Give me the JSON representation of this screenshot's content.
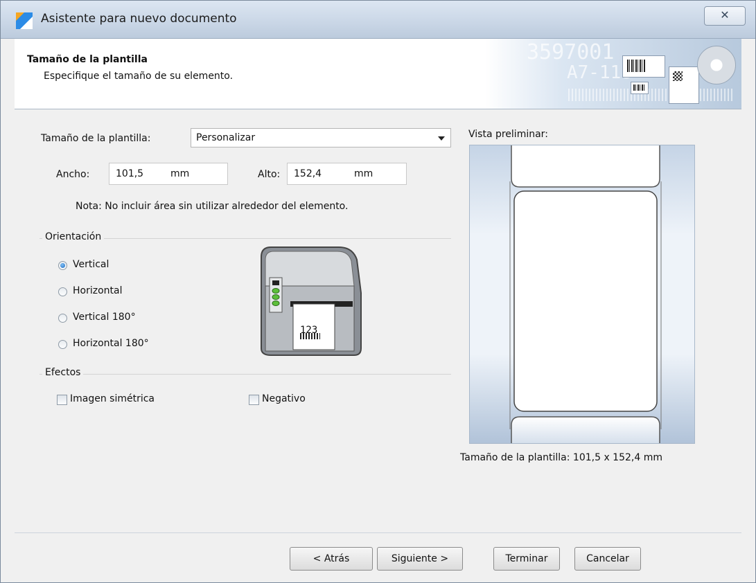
{
  "window": {
    "title": "Asistente para nuevo documento",
    "close_glyph": "✕"
  },
  "header": {
    "title": "Tamaño de la plantilla",
    "subtitle": "Especifique el tamaño de su elemento.",
    "banner_text_1": "3597001",
    "banner_text_2": "A7-118"
  },
  "form": {
    "size_label": "Tamaño de la plantilla:",
    "size_value": "Personalizar",
    "width_label": "Ancho:",
    "width_value": "101,5",
    "width_unit": "mm",
    "height_label": "Alto:",
    "height_value": "152,4",
    "height_unit": "mm",
    "note": "Nota: No incluir área sin utilizar alrededor del elemento."
  },
  "orientation": {
    "group_label": "Orientación",
    "options": [
      {
        "label": "Vertical",
        "selected": true
      },
      {
        "label": "Horizontal",
        "selected": false
      },
      {
        "label": "Vertical 180°",
        "selected": false
      },
      {
        "label": "Horizontal 180°",
        "selected": false
      }
    ],
    "printer_label_text": "123"
  },
  "effects": {
    "group_label": "Efectos",
    "mirror_label": "Imagen simétrica",
    "mirror_checked": false,
    "negative_label": "Negativo",
    "negative_checked": false
  },
  "preview": {
    "label": "Vista preliminar:",
    "size_text": "Tamaño de la plantilla:  101,5 x 152,4 mm"
  },
  "buttons": {
    "back": "< Atrás",
    "next": "Siguiente >",
    "finish": "Terminar",
    "cancel": "Cancelar"
  },
  "colors": {
    "title_bar": "#c9d6e6",
    "accent": "#2b8be6",
    "preview_bg": "#c5d4e6"
  }
}
